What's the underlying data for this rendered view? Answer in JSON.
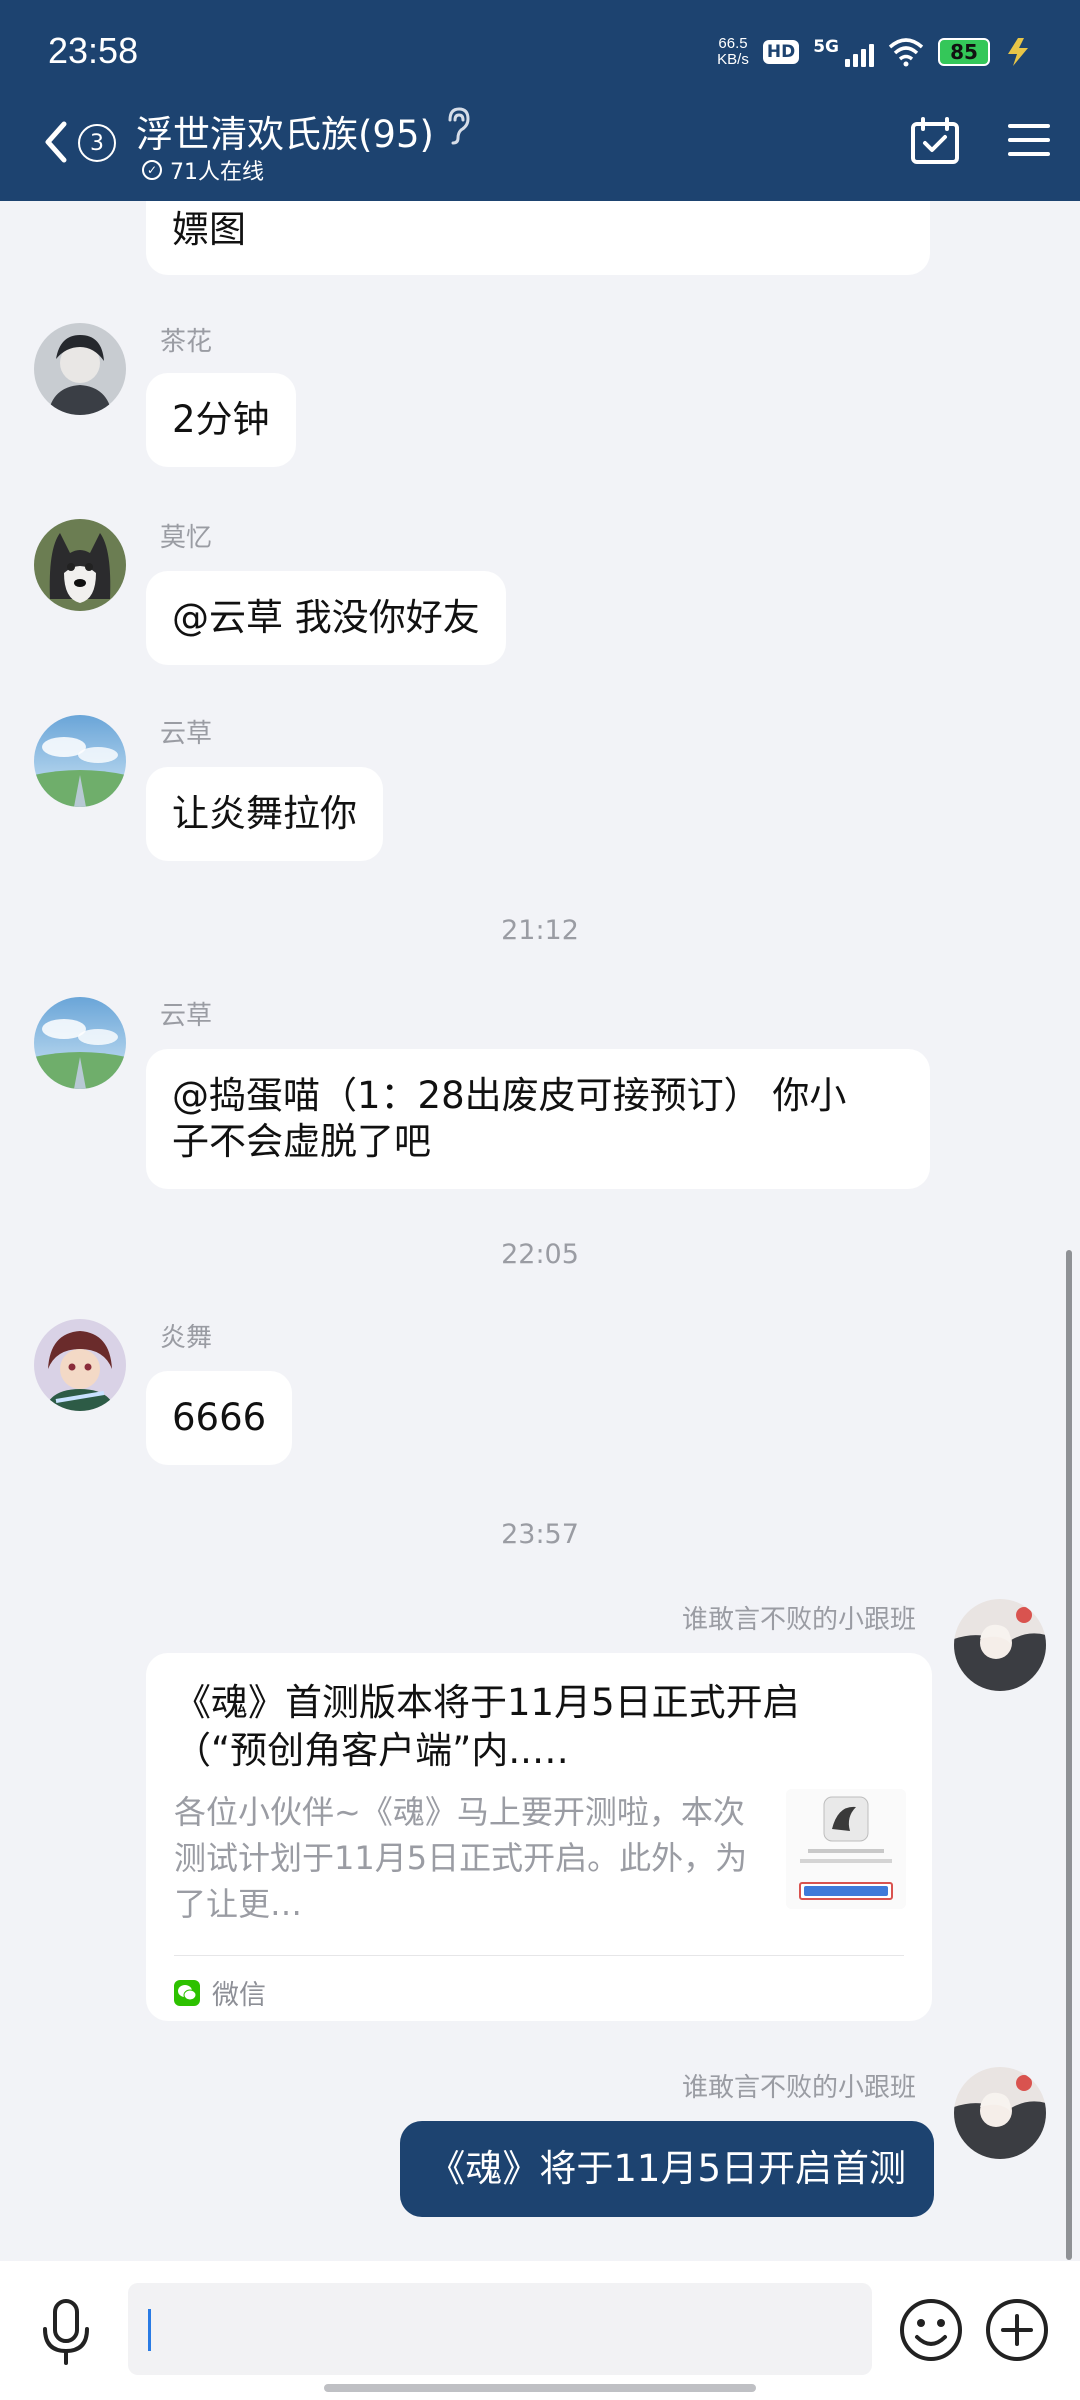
{
  "status_bar": {
    "time": "23:58",
    "net_speed_value": "66.5",
    "net_speed_unit": "KB/s",
    "hd_label": "HD",
    "network_label": "5G",
    "battery": "85"
  },
  "header": {
    "unread_count": "3",
    "title": "浮世清欢氏族(95)",
    "online": "71人在线"
  },
  "messages": [
    {
      "text": "嫖图"
    },
    {
      "sender": "茶花",
      "text": "2分钟"
    },
    {
      "sender": "莫忆",
      "text": "@云草 我没你好友"
    },
    {
      "sender": "云草",
      "text": "让炎舞拉你"
    },
    {
      "sender": "云草",
      "text_line1": "@捣蛋喵（1：28出废皮可接预订） 你小",
      "text_line2": "子不会虚脱了吧"
    },
    {
      "sender": "炎舞",
      "text": "6666"
    }
  ],
  "time_separators": [
    "21:12",
    "22:05",
    "23:57"
  ],
  "share_card": {
    "sender": "谁敢言不败的小跟班",
    "title_line1": "《魂》首测版本将于11月5日正式开启",
    "title_line2": "（“预创角客户端”内..…",
    "desc_line1": "各位小伙伴~《魂》马上要开测啦，本次",
    "desc_line2": "测试计划于11月5日正式开启。此外，为",
    "desc_line3": "了让更…",
    "source": "微信"
  },
  "self_message": {
    "sender": "谁敢言不败的小跟班",
    "text": "《魂》将于11月5日开启首测"
  },
  "input": {
    "value": "",
    "placeholder": ""
  },
  "colors": {
    "header": "#1d4370",
    "self_bubble": "#1d4370",
    "background": "#f2f3f7",
    "battery": "#34c759"
  }
}
